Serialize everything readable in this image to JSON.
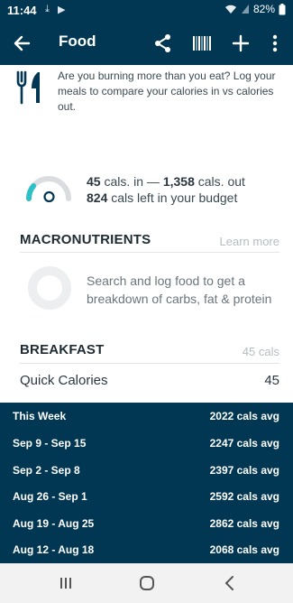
{
  "status_bar": {
    "time": "11:44",
    "battery": "82%"
  },
  "app_bar": {
    "title": "Food",
    "icons": [
      "back-arrow-icon",
      "share-icon",
      "barcode-icon",
      "plus-icon",
      "more-vert-icon"
    ]
  },
  "promo": {
    "text": "Are you burning more than you eat? Log your meals to compare your calories in vs calories out."
  },
  "budget": {
    "cals_in": "45",
    "cals_in_label": "cals. in —",
    "cals_out": "1,358",
    "cals_out_label": "cals. out",
    "left": "824",
    "left_label": "cals left in your budget",
    "gauge_fraction": 0.22
  },
  "macros": {
    "title": "MACRONUTRIENTS",
    "link": "Learn more",
    "message": "Search and log food to get a breakdown of carbs, fat & protein"
  },
  "breakfast": {
    "title": "BREAKFAST",
    "total": "45 cals",
    "items": [
      {
        "name": "Quick Calories",
        "value": "45"
      }
    ]
  },
  "weekly": [
    {
      "label": "This Week",
      "avg": "2022 cals avg"
    },
    {
      "label": "Sep 9 - Sep 15",
      "avg": "2247 cals avg"
    },
    {
      "label": "Sep 2 - Sep 8",
      "avg": "2397 cals avg"
    },
    {
      "label": "Aug 26 - Sep 1",
      "avg": "2592 cals avg"
    },
    {
      "label": "Aug 19 - Aug 25",
      "avg": "2862 cals avg"
    },
    {
      "label": "Aug 12 - Aug 18",
      "avg": "2068 cals avg"
    }
  ],
  "colors": {
    "header": "#013753",
    "accent": "#2fc0c7",
    "gauge_track": "#d9dde0"
  }
}
